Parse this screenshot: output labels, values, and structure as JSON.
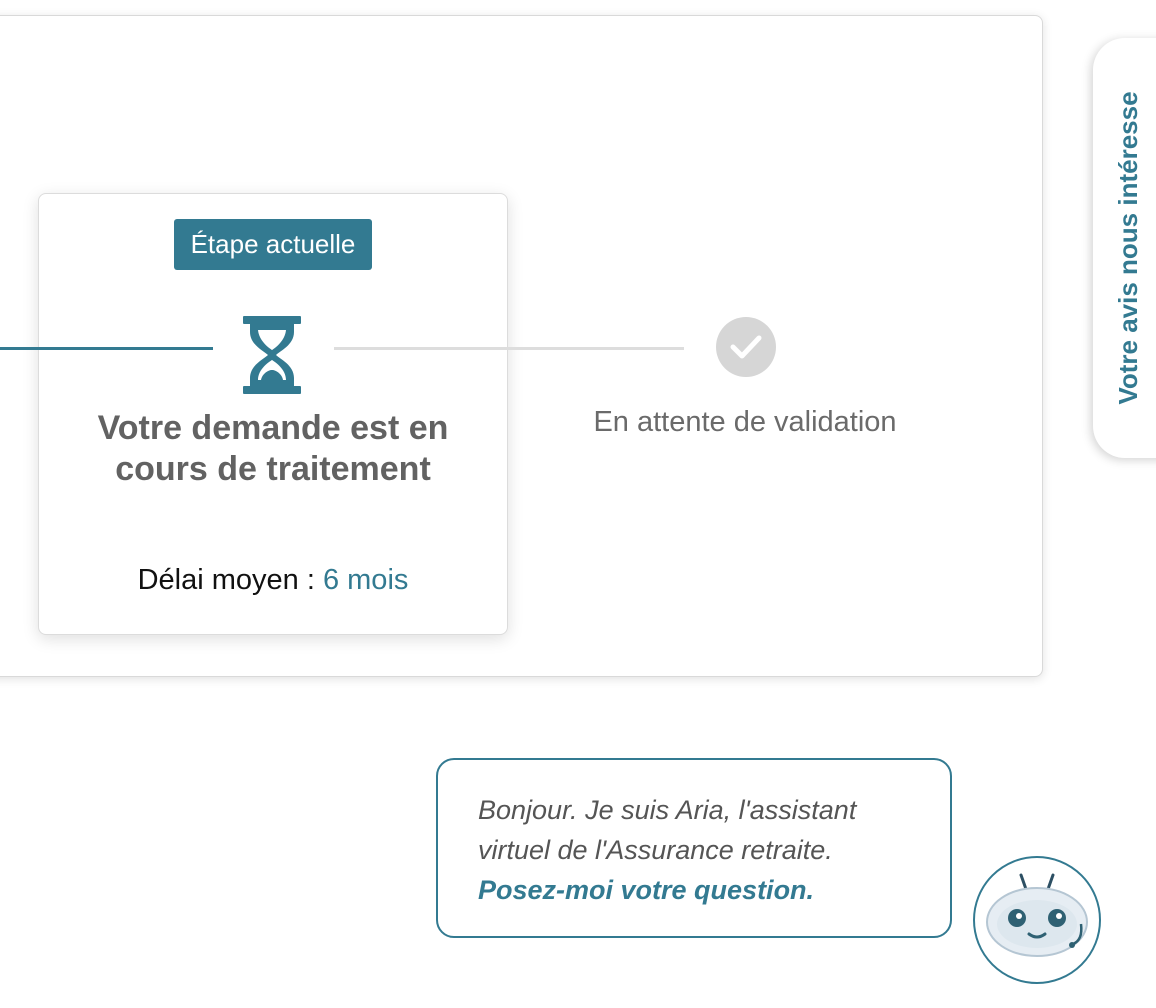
{
  "step_card": {
    "badge": "Étape actuelle",
    "title": "Votre demande est en cours de traitement",
    "delay_label": "Délai moyen : ",
    "delay_value": "6 mois"
  },
  "next_step": {
    "label": "En attente de validation"
  },
  "feedback_tab": {
    "label": "Votre avis nous intéresse"
  },
  "assistant": {
    "message": "Bonjour. Je suis Aria, l'assistant virtuel de l'Assurance retraite.",
    "cta": "Posez-moi votre question."
  },
  "icons": {
    "current_step": "hourglass-icon",
    "next_step": "check-icon",
    "assistant": "robot-icon"
  },
  "colors": {
    "accent": "#337a91",
    "pending_gray": "#d6d6d6"
  }
}
